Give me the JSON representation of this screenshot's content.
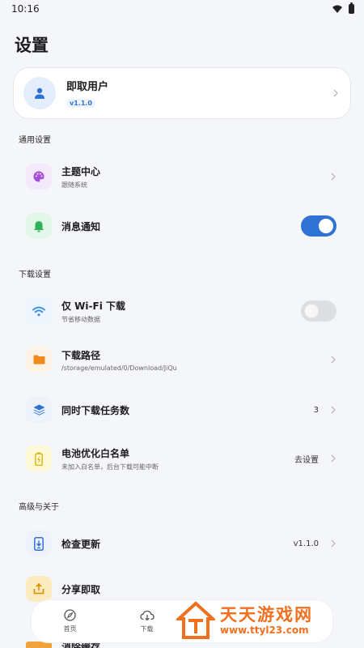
{
  "status_bar": {
    "time": "10:16"
  },
  "page": {
    "title": "设置"
  },
  "profile": {
    "name": "即取用户",
    "version": "v1.1.0"
  },
  "sections": {
    "general": "通用设置",
    "download": "下载设置",
    "advanced": "高级与关于"
  },
  "rows": {
    "theme": {
      "title": "主题中心",
      "subtitle": "跟随系统"
    },
    "notify": {
      "title": "消息通知",
      "enabled": true
    },
    "wifi": {
      "title": "仅 Wi-Fi 下载",
      "subtitle": "节省移动数据",
      "enabled": false
    },
    "path": {
      "title": "下载路径",
      "subtitle": "/storage/emulated/0/Download/JiQu"
    },
    "concurrent": {
      "title": "同时下载任务数",
      "value": "3"
    },
    "battery": {
      "title": "电池优化白名单",
      "subtitle": "未加入白名单，后台下载可能中断",
      "value": "去设置"
    },
    "update": {
      "title": "检查更新",
      "value": "v1.1.0"
    },
    "share": {
      "title": "分享即取"
    },
    "clear": {
      "title": "消除缓存"
    }
  },
  "nav": {
    "home": "首页",
    "download": "下载"
  },
  "watermark": {
    "title": "天天游戏网",
    "url": "www.ttyl23.com"
  },
  "colors": {
    "accent": "#2f72d4",
    "watermark": "#f07020",
    "background": "#f4f6f9"
  },
  "icons": {
    "theme": "palette-icon",
    "notify": "bell-icon",
    "wifi": "wifi-icon",
    "path": "folder-icon",
    "concurrent": "layers-icon",
    "battery": "battery-icon",
    "update": "phone-download-icon",
    "share": "share-icon",
    "home": "compass-icon",
    "download": "cloud-download-icon"
  }
}
